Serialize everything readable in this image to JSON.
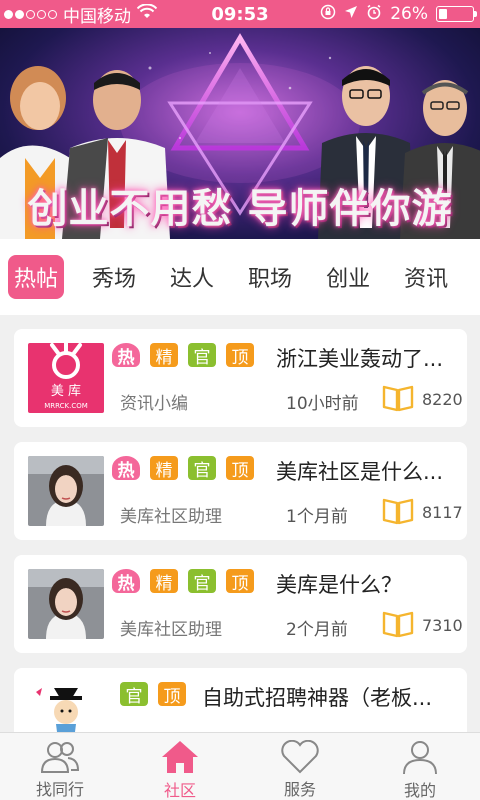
{
  "status_bar": {
    "carrier": "中国移动",
    "time": "09:53",
    "battery": "26%",
    "battery_level": 0.26,
    "signal_bars": 2,
    "signal_total": 5
  },
  "banner": {
    "title": "创业不用愁  导师伴你游",
    "slide_count": 6,
    "active_slide": 1
  },
  "tabs": [
    {
      "label": "热帖",
      "active": true
    },
    {
      "label": "秀场"
    },
    {
      "label": "达人"
    },
    {
      "label": "职场"
    },
    {
      "label": "创业"
    },
    {
      "label": "资讯"
    }
  ],
  "posts": [
    {
      "badges": [
        "热",
        "精",
        "官",
        "顶"
      ],
      "title": "浙江美业轰动了...",
      "author": "资讯小编",
      "time": "10小时前",
      "views": "8220",
      "thumb": "logo",
      "logo_text": "美 库",
      "logo_sub": "MRRCK.COM"
    },
    {
      "badges": [
        "热",
        "精",
        "官",
        "顶"
      ],
      "title": "美库社区是什么...",
      "author": "美库社区助理",
      "time": "1个月前",
      "views": "8117",
      "thumb": "person"
    },
    {
      "badges": [
        "热",
        "精",
        "官",
        "顶"
      ],
      "title": "美库是什么？",
      "author": "美库社区助理",
      "time": "2个月前",
      "views": "7310",
      "thumb": "person"
    },
    {
      "badges": [
        "官",
        "顶"
      ],
      "title": "自助式招聘神器（老板...",
      "author": "",
      "time": "",
      "views": "",
      "thumb": "cartoon"
    }
  ],
  "bottom_nav": [
    {
      "label": "找同行",
      "icon": "people-icon"
    },
    {
      "label": "社区",
      "icon": "home-icon",
      "active": true
    },
    {
      "label": "服务",
      "icon": "heart-icon"
    },
    {
      "label": "我的",
      "icon": "user-icon"
    }
  ],
  "colors": {
    "brand_pink": "#f05a8a",
    "badge_orange": "#f59b1c",
    "badge_green": "#8bbf2f",
    "badge_hot": "#f4679a"
  }
}
